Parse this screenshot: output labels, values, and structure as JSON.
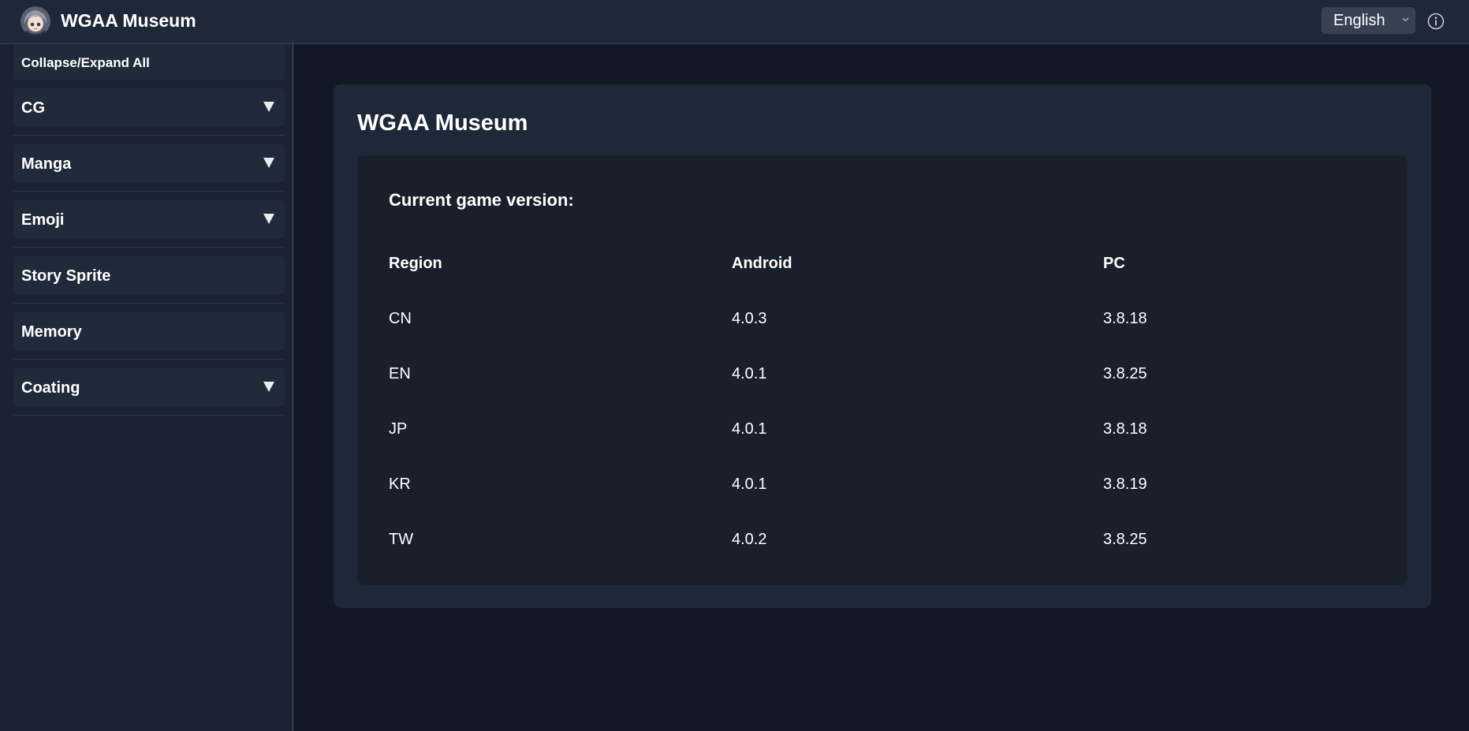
{
  "header": {
    "app_title": "WGAA Museum",
    "language": {
      "selected": "English"
    },
    "icons": {
      "logo": "avatar-logo",
      "info": "info-icon",
      "chevron": "chevron-down-icon"
    }
  },
  "sidebar": {
    "items": [
      {
        "label": "Collapse/Expand All",
        "expandable": false
      },
      {
        "label": "CG",
        "expandable": true
      },
      {
        "label": "Manga",
        "expandable": true
      },
      {
        "label": "Emoji",
        "expandable": true
      },
      {
        "label": "Story Sprite",
        "expandable": false
      },
      {
        "label": "Memory",
        "expandable": false
      },
      {
        "label": "Coating",
        "expandable": true
      }
    ],
    "expand_glyph": "▼"
  },
  "main": {
    "title": "WGAA Museum",
    "version_heading": "Current game version:",
    "table": {
      "columns": [
        "Region",
        "Android",
        "PC"
      ],
      "rows": [
        [
          "CN",
          "4.0.3",
          "3.8.18"
        ],
        [
          "EN",
          "4.0.1",
          "3.8.25"
        ],
        [
          "JP",
          "4.0.1",
          "3.8.18"
        ],
        [
          "KR",
          "4.0.1",
          "3.8.19"
        ],
        [
          "TW",
          "4.0.2",
          "3.8.25"
        ]
      ]
    }
  },
  "colors": {
    "page_bg": "#121826",
    "header_bg": "#1f2838",
    "sidebar_bg": "#1b2231",
    "card_bg": "#1f2838",
    "inner_bg": "#1a1f2c",
    "select_bg": "#374151"
  }
}
